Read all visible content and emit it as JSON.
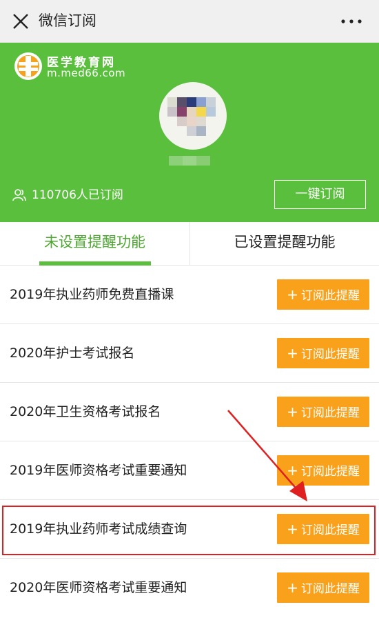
{
  "titlebar": {
    "close_icon": "close-icon",
    "title": "微信订阅",
    "more_icon": "more-icon"
  },
  "banner": {
    "background_color": "#5bbf3e",
    "logo": {
      "name": "医学教育网",
      "url": "m.med66.com"
    },
    "subscriber_count_text": "110706人已订阅",
    "subscribe_all_label": "一键订阅"
  },
  "tabs": [
    {
      "label": "未设置提醒功能",
      "active": true
    },
    {
      "label": "已设置提醒功能",
      "active": false
    }
  ],
  "accent_green": "#5bbf3e",
  "button_orange": "#f9a11b",
  "highlight_red": "#e02020",
  "list": {
    "button_label": "订阅此提醒",
    "button_plus": "+",
    "items": [
      {
        "title": "2019年执业药师免费直播课"
      },
      {
        "title": "2020年护士考试报名"
      },
      {
        "title": "2020年卫生资格考试报名"
      },
      {
        "title": "2019年医师资格考试重要通知"
      },
      {
        "title": "2019年执业药师考试成绩查询",
        "highlighted": true
      },
      {
        "title": "2020年医师资格考试重要通知"
      }
    ]
  }
}
